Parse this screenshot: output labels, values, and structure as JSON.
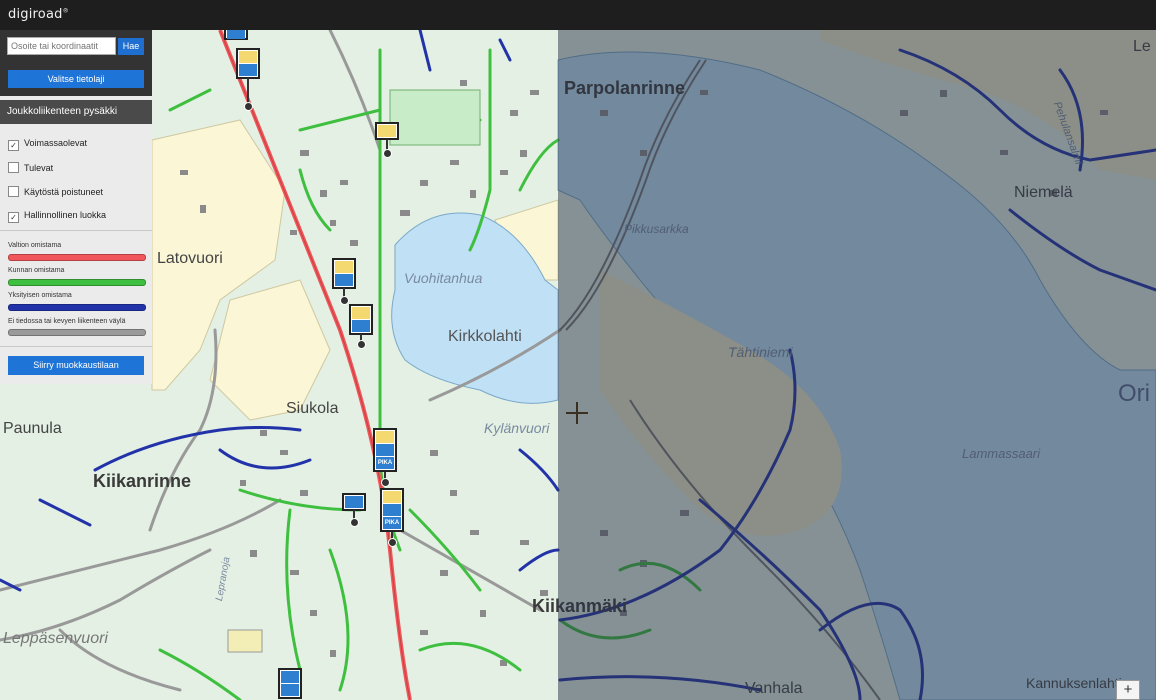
{
  "app": {
    "logo": "digiroad",
    "logo_mark": "®"
  },
  "search": {
    "placeholder": "Osoite tai koordinaatit",
    "button_label": "Hae"
  },
  "layer_button": "Valitse tietolaji",
  "section": {
    "title": "Joukkoliikenteen pysäkki"
  },
  "filters": [
    {
      "label": "Voimassaolevat",
      "checked": true
    },
    {
      "label": "Tulevat",
      "checked": false
    },
    {
      "label": "Käytöstä poistuneet",
      "checked": false
    },
    {
      "label": "Hallinnollinen luokka",
      "checked": true
    }
  ],
  "legend": [
    {
      "label": "Valtion omistama",
      "color": "#f0565a"
    },
    {
      "label": "Kunnan omistama",
      "color": "#3fbf3f"
    },
    {
      "label": "Yksityisen omistama",
      "color": "#2233aa"
    },
    {
      "label": "Ei tiedossa tai kevyen liikenteen väylä",
      "color": "#9a9a9a"
    }
  ],
  "edit_button": "Siirry muokkaustilaan",
  "map": {
    "places": [
      "Parpolanrinne",
      "Niemelä",
      "Latovuori",
      "Siukola",
      "Paunula",
      "Kiikanrinne",
      "Kiikanmäki",
      "Vanhala",
      "Kannuksenlahti",
      "Leppäsenvuori",
      "Le",
      "Ori"
    ],
    "water_names": [
      "Vuohitanhua",
      "Kirkkolahti",
      "Kylänvuori",
      "Tähtiniemi",
      "Lammassaari",
      "Pikkusarkka",
      "Pehulansalmi",
      "Lepranoja"
    ],
    "zoom_in": "+",
    "stop_badge": "PIKA"
  }
}
